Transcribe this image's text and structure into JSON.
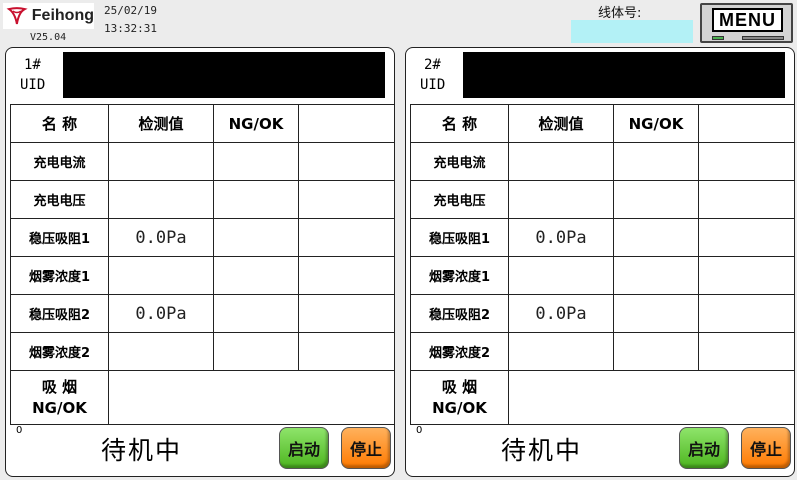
{
  "header": {
    "brand": "Feihong",
    "version": "V25.04",
    "date": "25/02/19",
    "time": "13:32:31",
    "line_label": "线体号:",
    "line_value": "",
    "menu_label": "MENU"
  },
  "panels": [
    {
      "station": "1#",
      "uid_label": "UID",
      "headers": [
        "名  称",
        "检测值",
        "NG/OK",
        ""
      ],
      "rows": [
        {
          "name": "充电电流",
          "value": "",
          "result": ""
        },
        {
          "name": "充电电压",
          "value": "",
          "result": ""
        },
        {
          "name": "稳压吸阻1",
          "value": "0.0Pa",
          "result": ""
        },
        {
          "name": "烟雾浓度1",
          "value": "",
          "result": ""
        },
        {
          "name": "稳压吸阻2",
          "value": "0.0Pa",
          "result": ""
        },
        {
          "name": "烟雾浓度2",
          "value": "",
          "result": ""
        }
      ],
      "smoke_label_1": "吸 烟",
      "smoke_label_2": "NG/OK",
      "counter": "0",
      "status": "待机中",
      "start_label": "启动",
      "stop_label": "停止"
    },
    {
      "station": "2#",
      "uid_label": "UID",
      "headers": [
        "名  称",
        "检测值",
        "NG/OK",
        ""
      ],
      "rows": [
        {
          "name": "充电电流",
          "value": "",
          "result": ""
        },
        {
          "name": "充电电压",
          "value": "",
          "result": ""
        },
        {
          "name": "稳压吸阻1",
          "value": "0.0Pa",
          "result": ""
        },
        {
          "name": "烟雾浓度1",
          "value": "",
          "result": ""
        },
        {
          "name": "稳压吸阻2",
          "value": "0.0Pa",
          "result": ""
        },
        {
          "name": "烟雾浓度2",
          "value": "",
          "result": ""
        }
      ],
      "smoke_label_1": "吸 烟",
      "smoke_label_2": "NG/OK",
      "counter": "0",
      "status": "待机中",
      "start_label": "启动",
      "stop_label": "停止"
    }
  ],
  "colors": {
    "line_input_bg": "#b3f1f6",
    "start_button": "#5cc42c",
    "stop_button": "#ff8a10",
    "uid_bar": "#000000"
  }
}
